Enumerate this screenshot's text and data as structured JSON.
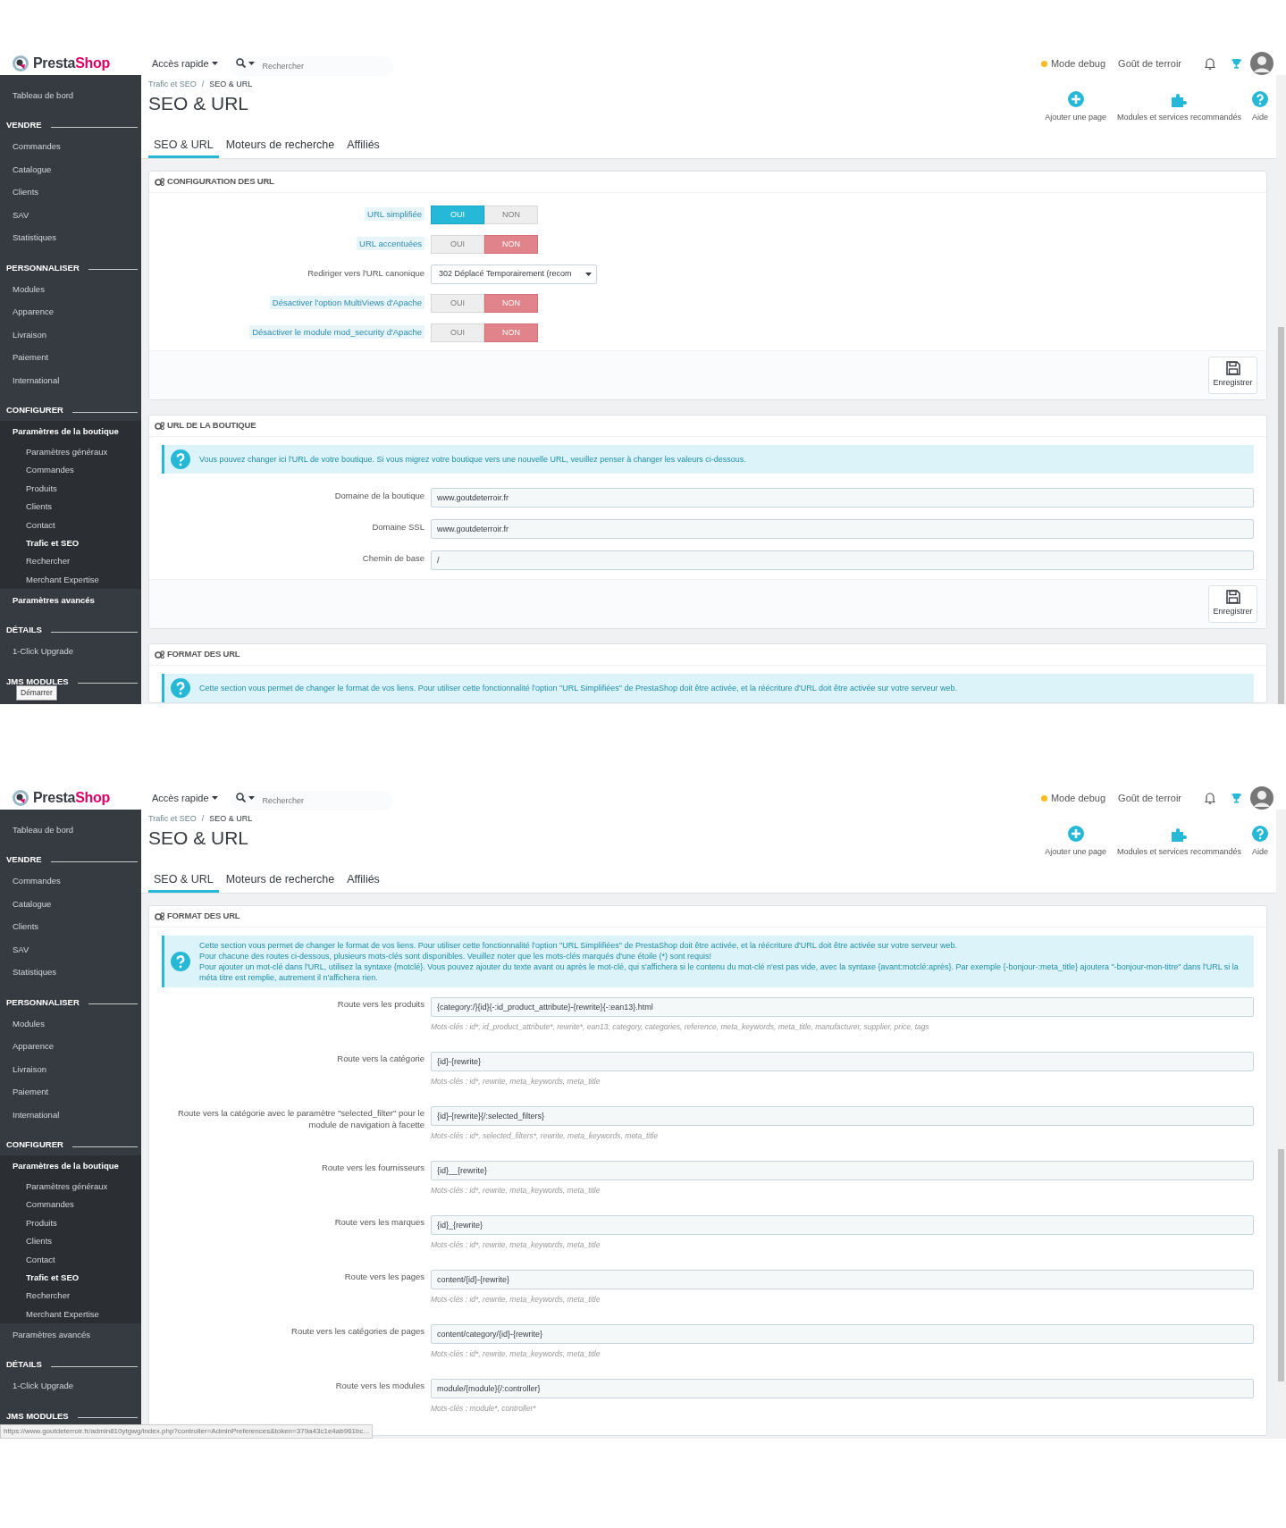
{
  "screens": [
    {
      "header": {
        "logo": {
          "first": "Presta",
          "second": "Shop"
        },
        "quick_access": "Accès rapide",
        "search": {
          "placeholder": "Rechercher"
        },
        "debug": "Mode debug",
        "shop_name": "Goût de terroir"
      },
      "sidebar": [
        {
          "kind": "link",
          "label": "Tableau de bord",
          "selected": false
        },
        {
          "kind": "section",
          "label": "VENDRE"
        },
        {
          "kind": "link",
          "label": "Commandes",
          "selected": false
        },
        {
          "kind": "link",
          "label": "Catalogue",
          "selected": false
        },
        {
          "kind": "link",
          "label": "Clients",
          "selected": false
        },
        {
          "kind": "link",
          "label": "SAV",
          "selected": false
        },
        {
          "kind": "link",
          "label": "Statistiques",
          "selected": false
        },
        {
          "kind": "section",
          "label": "PERSONNALISER"
        },
        {
          "kind": "link",
          "label": "Modules",
          "selected": false
        },
        {
          "kind": "link",
          "label": "Apparence",
          "selected": false
        },
        {
          "kind": "link",
          "label": "Livraison",
          "selected": false
        },
        {
          "kind": "link",
          "label": "Paiement",
          "selected": false
        },
        {
          "kind": "link",
          "label": "International",
          "selected": false
        },
        {
          "kind": "section",
          "label": "CONFIGURER"
        },
        {
          "kind": "link",
          "label": "Paramètres de la boutique",
          "selected": true,
          "children": [
            {
              "label": "Paramètres généraux",
              "selected": false
            },
            {
              "label": "Commandes",
              "selected": false
            },
            {
              "label": "Produits",
              "selected": false
            },
            {
              "label": "Clients",
              "selected": false
            },
            {
              "label": "Contact",
              "selected": false
            },
            {
              "label": "Trafic et SEO",
              "selected": true
            },
            {
              "label": "Rechercher",
              "selected": false
            },
            {
              "label": "Merchant Expertise",
              "selected": false
            }
          ]
        },
        {
          "kind": "link",
          "label": "Paramètres avancés",
          "selected": true
        },
        {
          "kind": "section",
          "label": "DÉTAILS"
        },
        {
          "kind": "link",
          "label": "1-Click Upgrade",
          "selected": false
        },
        {
          "kind": "section",
          "label": "JMS MODULES"
        }
      ],
      "breadcrumb": {
        "items": [
          "Trafic et SEO",
          "SEO & URL"
        ],
        "separator": "/"
      },
      "title": "SEO & URL",
      "toolbar": [
        "Ajouter une page",
        "Modules et services recommandés",
        "Aide"
      ],
      "tabs": [
        {
          "label": "SEO & URL",
          "selected": true
        },
        {
          "label": "Moteurs de recherche",
          "selected": false
        },
        {
          "label": "Affiliés",
          "selected": false
        }
      ],
      "panels": [
        {
          "title": "CONFIGURATION DES URL",
          "fields": [
            {
              "kind": "toggle",
              "label": "URL simplifiée",
              "help": true,
              "options": [
                {
                  "label": "OUI",
                  "selected": true
                },
                {
                  "label": "NON",
                  "selected": false
                }
              ]
            },
            {
              "kind": "toggle",
              "label": "URL accentuées",
              "help": true,
              "options": [
                {
                  "label": "OUI",
                  "selected": false
                },
                {
                  "label": "NON",
                  "selected": true
                }
              ]
            },
            {
              "kind": "select",
              "label": "Rediriger vers l'URL canonique",
              "help": false,
              "value": "302 Déplacé Temporairement (recom"
            },
            {
              "kind": "toggle",
              "label": "Désactiver l'option MultiViews d'Apache",
              "help": true,
              "options": [
                {
                  "label": "OUI",
                  "selected": false
                },
                {
                  "label": "NON",
                  "selected": true
                }
              ]
            },
            {
              "kind": "toggle",
              "label": "Désactiver le module mod_security d'Apache",
              "help": true,
              "options": [
                {
                  "label": "OUI",
                  "selected": false
                },
                {
                  "label": "NON",
                  "selected": true
                }
              ]
            }
          ],
          "save": "Enregistrer"
        },
        {
          "title": "URL DE LA BOUTIQUE",
          "info": [
            "Vous pouvez changer ici l'URL de votre boutique. Si vous migrez votre boutique vers une nouvelle URL, veuillez penser à changer les valeurs ci-dessous."
          ],
          "fields": [
            {
              "kind": "text",
              "label": "Domaine de la boutique",
              "help": false,
              "value": "www.goutdeterroir.fr"
            },
            {
              "kind": "text",
              "label": "Domaine SSL",
              "help": false,
              "value": "www.goutdeterroir.fr"
            },
            {
              "kind": "text",
              "label": "Chemin de base",
              "help": false,
              "value": "/"
            }
          ],
          "save": "Enregistrer"
        },
        {
          "title": "FORMAT DES URL",
          "info": [
            "Cette section vous permet de changer le format de vos liens. Pour utiliser cette fonctionnalité l'option \"URL Simplifiées\" de PrestaShop doit être activée, et la réécriture d'URL doit être activée sur votre serveur web."
          ]
        }
      ],
      "tooltip": "Démarrer"
    },
    {
      "header": {
        "logo": {
          "first": "Presta",
          "second": "Shop"
        },
        "quick_access": "Accès rapide",
        "search": {
          "placeholder": "Rechercher"
        },
        "debug": "Mode debug",
        "shop_name": "Goût de terroir"
      },
      "sidebar": [
        {
          "kind": "link",
          "label": "Tableau de bord",
          "selected": false
        },
        {
          "kind": "section",
          "label": "VENDRE"
        },
        {
          "kind": "link",
          "label": "Commandes",
          "selected": false
        },
        {
          "kind": "link",
          "label": "Catalogue",
          "selected": false
        },
        {
          "kind": "link",
          "label": "Clients",
          "selected": false
        },
        {
          "kind": "link",
          "label": "SAV",
          "selected": false
        },
        {
          "kind": "link",
          "label": "Statistiques",
          "selected": false
        },
        {
          "kind": "section",
          "label": "PERSONNALISER"
        },
        {
          "kind": "link",
          "label": "Modules",
          "selected": false
        },
        {
          "kind": "link",
          "label": "Apparence",
          "selected": false
        },
        {
          "kind": "link",
          "label": "Livraison",
          "selected": false
        },
        {
          "kind": "link",
          "label": "Paiement",
          "selected": false
        },
        {
          "kind": "link",
          "label": "International",
          "selected": false
        },
        {
          "kind": "section",
          "label": "CONFIGURER"
        },
        {
          "kind": "link",
          "label": "Paramètres de la boutique",
          "selected": true,
          "children": [
            {
              "label": "Paramètres généraux",
              "selected": false
            },
            {
              "label": "Commandes",
              "selected": false
            },
            {
              "label": "Produits",
              "selected": false
            },
            {
              "label": "Clients",
              "selected": false
            },
            {
              "label": "Contact",
              "selected": false
            },
            {
              "label": "Trafic et SEO",
              "selected": true
            },
            {
              "label": "Rechercher",
              "selected": false
            },
            {
              "label": "Merchant Expertise",
              "selected": false
            }
          ]
        },
        {
          "kind": "link",
          "label": "Paramètres avancés",
          "selected": false
        },
        {
          "kind": "section",
          "label": "DÉTAILS"
        },
        {
          "kind": "link",
          "label": "1-Click Upgrade",
          "selected": false
        },
        {
          "kind": "section",
          "label": "JMS MODULES"
        }
      ],
      "breadcrumb": {
        "items": [
          "Trafic et SEO",
          "SEO & URL"
        ],
        "separator": "/"
      },
      "title": "SEO & URL",
      "toolbar": [
        "Ajouter une page",
        "Modules et services recommandés",
        "Aide"
      ],
      "tabs": [
        {
          "label": "SEO & URL",
          "selected": true
        },
        {
          "label": "Moteurs de recherche",
          "selected": false
        },
        {
          "label": "Affiliés",
          "selected": false
        }
      ],
      "panels": [
        {
          "title": "FORMAT DES URL",
          "info": [
            "Cette section vous permet de changer le format de vos liens. Pour utiliser cette fonctionnalité l'option \"URL Simplifiées\" de PrestaShop doit être activée, et la réécriture d'URL doit être activée sur votre serveur web.",
            "Pour chacune des routes ci-dessous, plusieurs mots-clés sont disponibles. Veuillez noter que les mots-clés marqués d'une étoile (*) sont requis!",
            "Pour ajouter un mot-clé dans l'URL, utilisez la syntaxe {motclé}. Vous pouvez ajouter du texte avant ou après le mot-clé, qui s'affichera si le contenu du mot-clé n'est pas vide, avec la syntaxe {avant:motclé:après}. Par exemple {-bonjour-:meta_title} ajoutera \"-bonjour-mon-titre\" dans l'URL si la méta titre est remplie, autrement il n'affichera rien."
          ],
          "fields": [
            {
              "kind": "route",
              "label": "Route vers les produits",
              "value": "{category:/}{id}{-:id_product_attribute}-{rewrite}{-:ean13}.html",
              "hint": "Mots-clés : id*, id_product_attribute*, rewrite*, ean13, category, categories, reference, meta_keywords, meta_title, manufacturer, supplier, price, tags"
            },
            {
              "kind": "route",
              "label": "Route vers la catégorie",
              "value": "{id}-{rewrite}",
              "hint": "Mots-clés : id*, rewrite, meta_keywords, meta_title"
            },
            {
              "kind": "route",
              "label": "Route vers la catégorie avec le paramètre \"selected_filter\" pour le module de navigation à facette",
              "value": "{id}-{rewrite}{/:selected_filters}",
              "hint": "Mots-clés : id*, selected_filters*, rewrite, meta_keywords, meta_title"
            },
            {
              "kind": "route",
              "label": "Route vers les fournisseurs",
              "value": "{id}__{rewrite}",
              "hint": "Mots-clés : id*, rewrite, meta_keywords, meta_title"
            },
            {
              "kind": "route",
              "label": "Route vers les marques",
              "value": "{id}_{rewrite}",
              "hint": "Mots-clés : id*, rewrite, meta_keywords, meta_title"
            },
            {
              "kind": "route",
              "label": "Route vers les pages",
              "value": "content/{id}-{rewrite}",
              "hint": "Mots-clés : id*, rewrite, meta_keywords, meta_title"
            },
            {
              "kind": "route",
              "label": "Route vers les catégories de pages",
              "value": "content/category/{id}-{rewrite}",
              "hint": "Mots-clés : id*, rewrite, meta_keywords, meta_title"
            },
            {
              "kind": "route",
              "label": "Route vers les modules",
              "value": "module/{module}{/:controller}",
              "hint": "Mots-clés : module*, controller*"
            }
          ]
        }
      ],
      "status_bar": "https://www.goutdeterroir.fr/admin810ytgwg/index.php?controller=AdminPreferences&token=379a43c1e4ab961bc..."
    }
  ]
}
